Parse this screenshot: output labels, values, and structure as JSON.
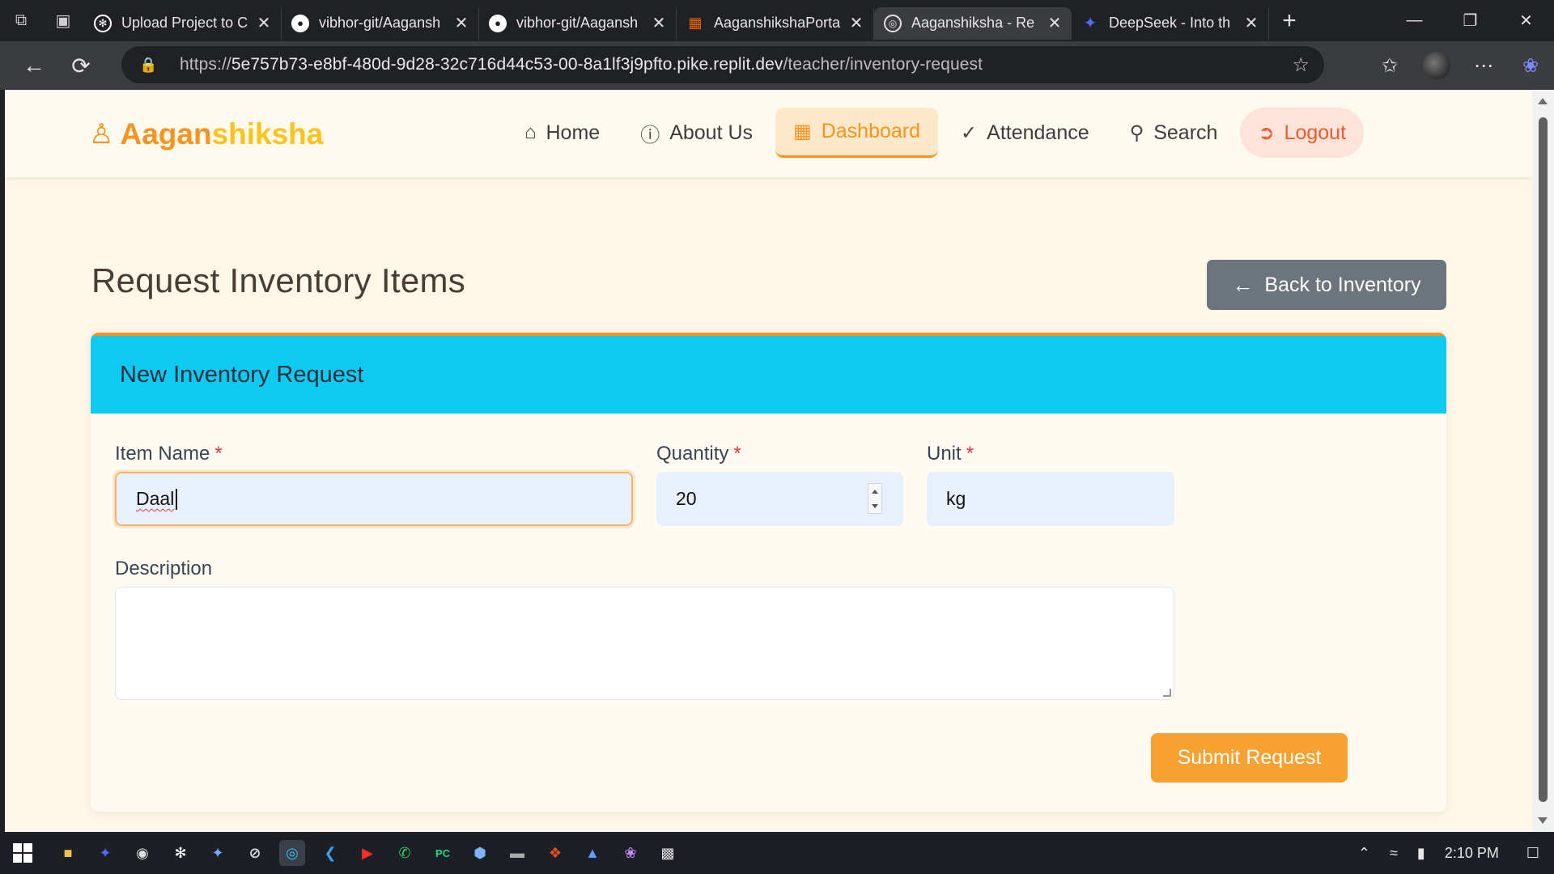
{
  "browser": {
    "tabs": [
      {
        "title": "Upload Project to C",
        "favicon": "chatgpt-icon",
        "color": "#ffffff"
      },
      {
        "title": "vibhor-git/Aagansh",
        "favicon": "github-icon",
        "color": "#ffffff"
      },
      {
        "title": "vibhor-git/Aagansh",
        "favicon": "github-icon",
        "color": "#ffffff"
      },
      {
        "title": "AaganshikshaPorta",
        "favicon": "replit-icon",
        "color": "#f26207"
      },
      {
        "title": "Aaganshiksha - Re",
        "favicon": "globe-icon",
        "color": "#ffffff",
        "active": true
      },
      {
        "title": "DeepSeek - Into th",
        "favicon": "deepseek-icon",
        "color": "#4d6bfe"
      }
    ],
    "url_prefix": "https://",
    "url_host": "5e757b73-e8bf-480d-9d28-32c716d44c53-00-8a1lf3j9pfto.pike.replit.dev",
    "url_path": "/teacher/inventory-request"
  },
  "site": {
    "logo_part1": "Aagan",
    "logo_part2": "shiksha",
    "nav": {
      "home": "Home",
      "about": "About Us",
      "dashboard": "Dashboard",
      "attendance": "Attendance",
      "search": "Search",
      "logout": "Logout"
    },
    "accent": "#f7931e"
  },
  "page": {
    "title": "Request Inventory Items",
    "back_button": "Back to Inventory",
    "card_title": "New Inventory Request",
    "form": {
      "item_name_label": "Item Name",
      "item_name_value": "Daal",
      "quantity_label": "Quantity",
      "quantity_value": "20",
      "unit_label": "Unit",
      "unit_value": "kg",
      "description_label": "Description",
      "description_value": "",
      "required_mark": "*",
      "submit": "Submit Request"
    }
  },
  "taskbar": {
    "time": "2:10 PM"
  }
}
